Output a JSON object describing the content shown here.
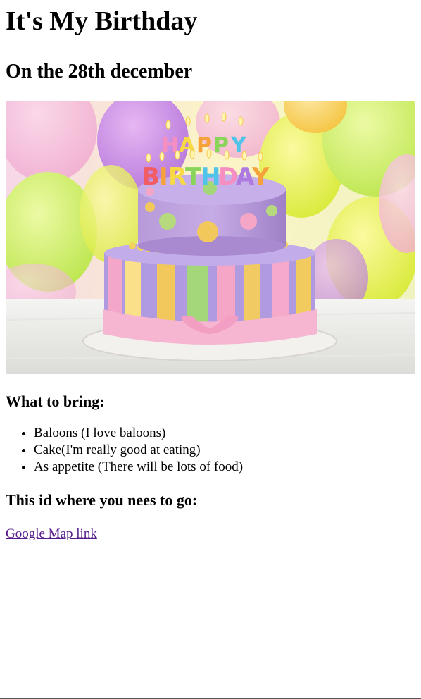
{
  "page": {
    "title": "It's My Birthday",
    "date_heading": "On the 28th december",
    "image_alt": "Birthday cake",
    "cake_candles_text": [
      "HAPPY",
      "BIRTHDAY"
    ],
    "bring_heading": "What to bring:",
    "bring_items": [
      "Baloons (I love baloons)",
      "Cake(I'm really good at eating)",
      "As appetite (There will be lots of food)"
    ],
    "location_heading": "This id where you nees to go:",
    "map_link_text": "Google Map link"
  },
  "colors": {
    "link_visited": "#551a8b",
    "text": "#000000",
    "background": "#ffffff"
  }
}
